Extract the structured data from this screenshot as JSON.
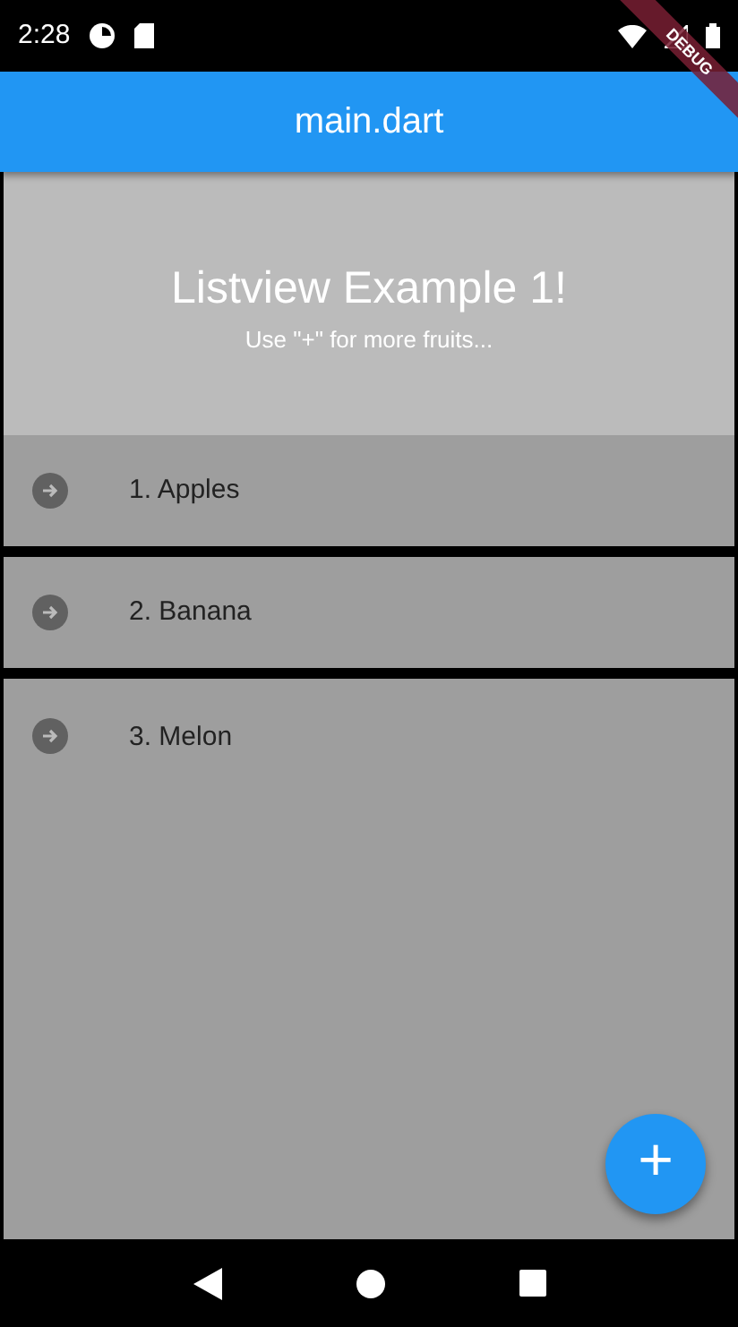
{
  "status_bar": {
    "time": "2:28"
  },
  "app_bar": {
    "title": "main.dart"
  },
  "debug_banner": {
    "label": "DEBUG"
  },
  "header": {
    "title": "Listview Example 1!",
    "subtitle": "Use \"+\" for more fruits..."
  },
  "items": [
    {
      "label": "1. Apples"
    },
    {
      "label": "2. Banana"
    },
    {
      "label": "3. Melon"
    }
  ],
  "fab": {
    "label": "+"
  }
}
